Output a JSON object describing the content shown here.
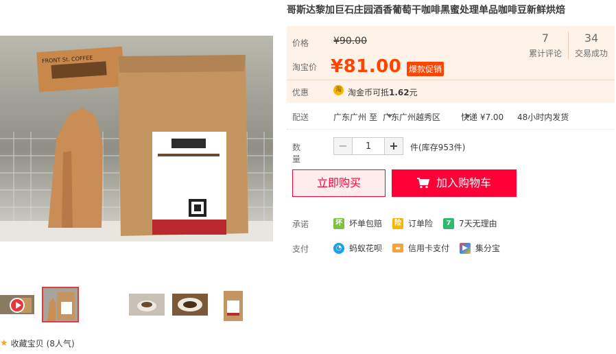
{
  "title": "哥斯达黎加巨石庄园酒香葡萄干咖啡黑蜜处理单品咖啡豆新鲜烘焙",
  "price": {
    "original_label": "价格",
    "original_value": "¥90.00",
    "taobao_label": "淘宝价",
    "taobao_value": "¥81.00",
    "promo_badge": "爆款促销"
  },
  "stats": {
    "comments_count": "7",
    "comments_label": "累计评论",
    "deals_count": "34",
    "deals_label": "交易成功"
  },
  "discount": {
    "label": "优惠",
    "icon_text": "淘",
    "text_prefix": "淘金币可抵",
    "amount": "1.62",
    "unit": "元"
  },
  "shipping": {
    "label": "配送",
    "from": "广东广州",
    "to_word": "至",
    "destination": "广东广州越秀区",
    "method": "快递 ¥7.00",
    "dispatch": "48小时内发货"
  },
  "quantity": {
    "label": "数量",
    "minus": "−",
    "value": "1",
    "plus": "+",
    "stock_text": "件(库存953件)"
  },
  "actions": {
    "buy_now": "立即购买",
    "add_to_cart": "加入购物车"
  },
  "promise": {
    "label": "承诺",
    "items": [
      {
        "icon": "broken-return-icon",
        "icon_char": "坏",
        "text": "坏单包赔",
        "color": "#7dc242"
      },
      {
        "icon": "order-insurance-icon",
        "icon_char": "险",
        "text": "订单险",
        "color": "#f5b700"
      },
      {
        "icon": "seven-day-return-icon",
        "icon_char": "7",
        "text": "7天无理由",
        "color": "#2fb96b"
      }
    ]
  },
  "payment": {
    "label": "支付",
    "items": [
      {
        "icon": "huabei-icon",
        "text": "蚂蚁花呗",
        "color": "#1aa0e8"
      },
      {
        "icon": "credit-card-icon",
        "text": "信用卡支付",
        "color": "#f7a23b"
      },
      {
        "icon": "jifenbao-icon",
        "text": "集分宝",
        "color": "#e94e3c"
      }
    ]
  },
  "favorite": {
    "icon": "star-icon",
    "label": "收藏宝贝",
    "popularity": "(8人气)"
  },
  "colors": {
    "price_red": "#ff4400",
    "buy_red": "#ff0036",
    "price_bg": "#fff2e8"
  }
}
